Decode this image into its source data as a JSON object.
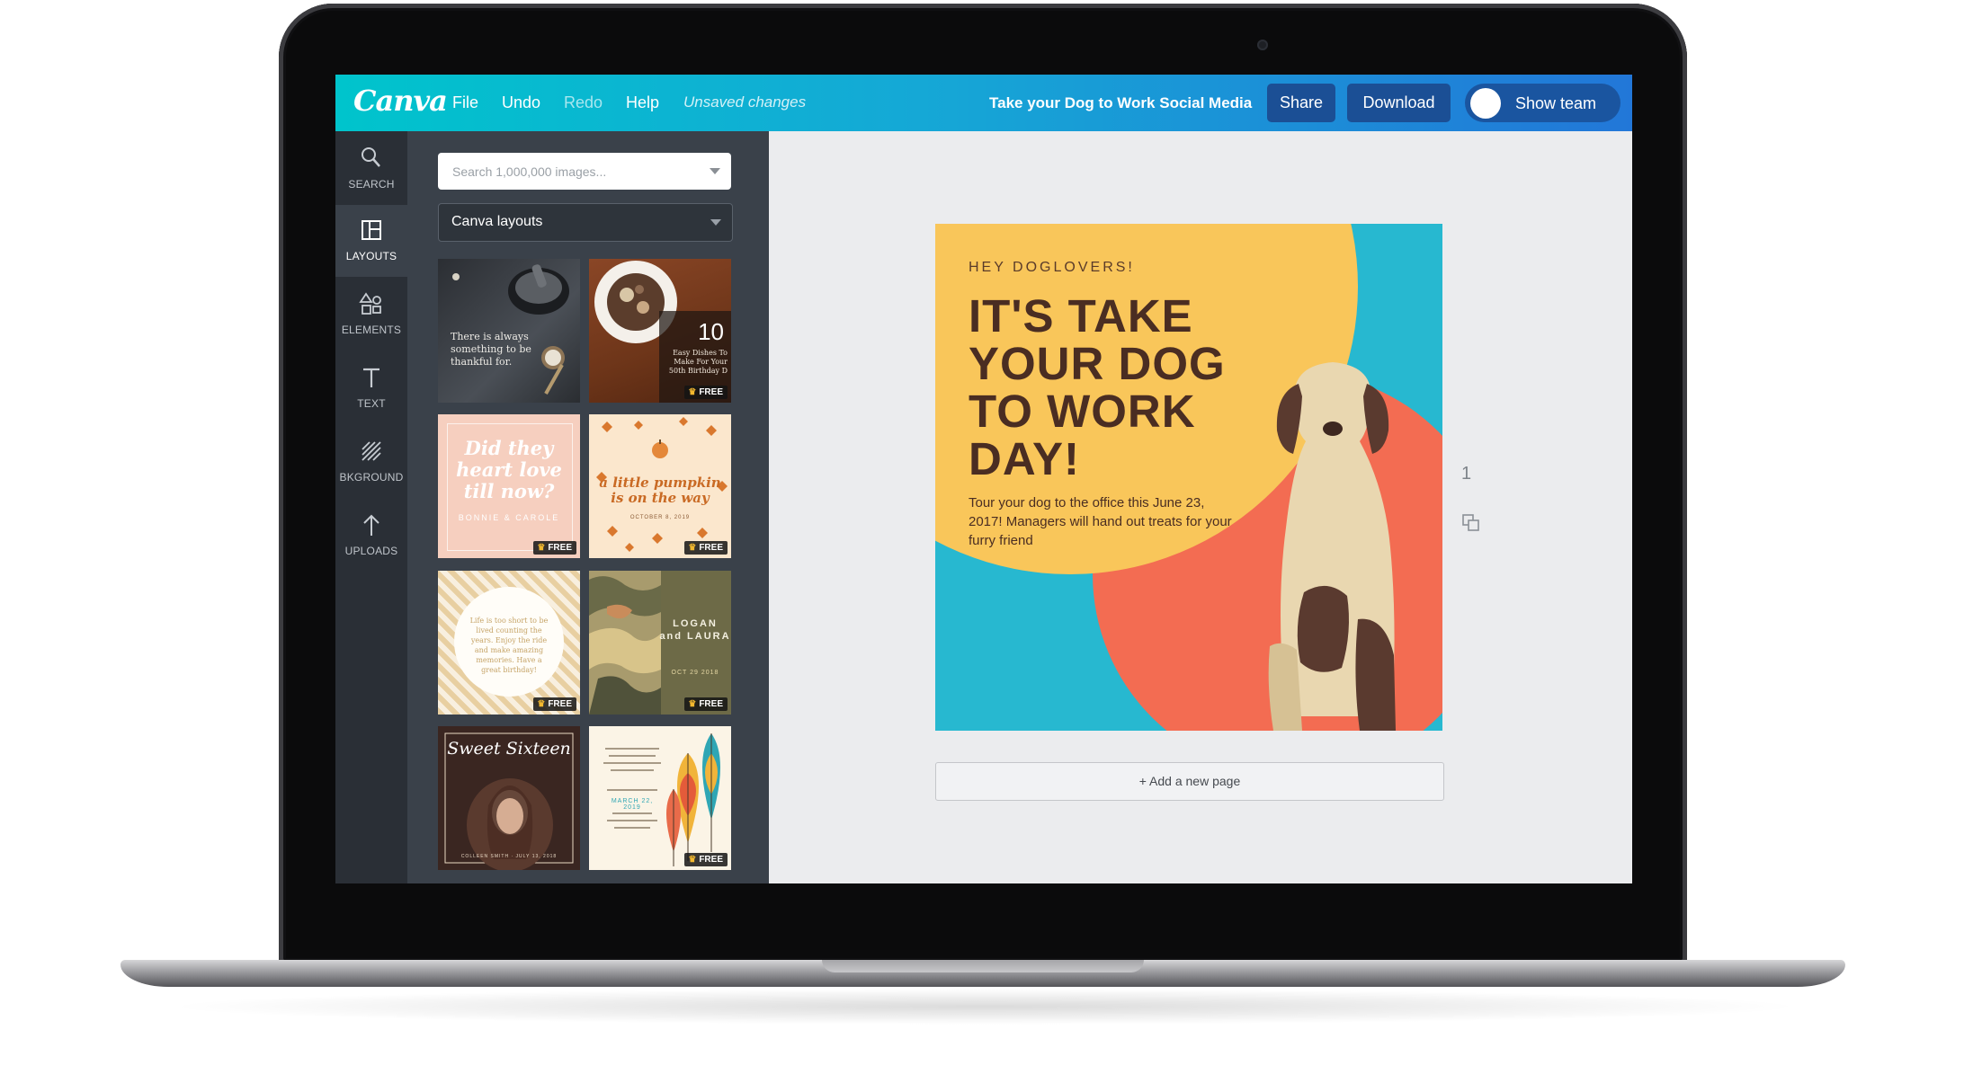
{
  "app": {
    "logo": "Canva",
    "menu": [
      {
        "label": "File"
      },
      {
        "label": "Undo"
      },
      {
        "label": "Redo"
      },
      {
        "label": "Help"
      }
    ],
    "status": "Unsaved changes",
    "document_title": "Take your Dog to Work Social Media",
    "share_label": "Share",
    "download_label": "Download",
    "show_team_label": "Show team"
  },
  "sidebar": {
    "items": [
      {
        "label": "SEARCH",
        "icon": "search-icon"
      },
      {
        "label": "LAYOUTS",
        "icon": "layouts-icon",
        "active": true
      },
      {
        "label": "ELEMENTS",
        "icon": "elements-icon"
      },
      {
        "label": "TEXT",
        "icon": "text-icon"
      },
      {
        "label": "BKGROUND",
        "icon": "background-icon"
      },
      {
        "label": "UPLOADS",
        "icon": "upload-icon"
      }
    ]
  },
  "panel": {
    "search_placeholder": "Search 1,000,000 images...",
    "layout_select": "Canva layouts",
    "free_badge": "FREE",
    "thumbnails": [
      {
        "text": "There is always something to be thankful for."
      },
      {
        "number": "10",
        "text": "Easy Dishes To Make For Your 50th Birthday D"
      },
      {
        "text": "Did they heart love till now?",
        "sub": "BONNIE & CAROLE"
      },
      {
        "text": "a little pumpkin is on the way",
        "sub": "OCTOBER 8, 2019"
      },
      {
        "text": "Life is too short to be lived counting the years. Enjoy the ride and make amazing memories. Have a great birthday!"
      },
      {
        "text": "LOGAN and LAURA",
        "sub": "OCT 29 2018"
      },
      {
        "text": "Sweet Sixteen",
        "sub": "COLLEEN SMITH · JULY 13, 2018"
      },
      {
        "text": "MARCH 22, 2019"
      }
    ]
  },
  "design": {
    "kicker": "HEY DOGLOVERS!",
    "headline": "IT'S TAKE YOUR DOG TO WORK DAY!",
    "body": "Tour your dog to the office this June 23, 2017! Managers will hand out treats for your furry friend",
    "add_page_label": "+ Add a new page",
    "page_number": "1",
    "colors": {
      "teal": "#27b8d0",
      "yellow": "#f9c65a",
      "coral": "#f36c52",
      "brown": "#4a2d22",
      "dog": "#e9d7b0",
      "dog_dark": "#5a3a2f"
    }
  },
  "colors": {
    "topbar_start": "#00c4cc",
    "topbar_end": "#2277d8",
    "sidebar": "#2a2f36",
    "panel": "#3a414a",
    "button": "#1b4f95"
  }
}
